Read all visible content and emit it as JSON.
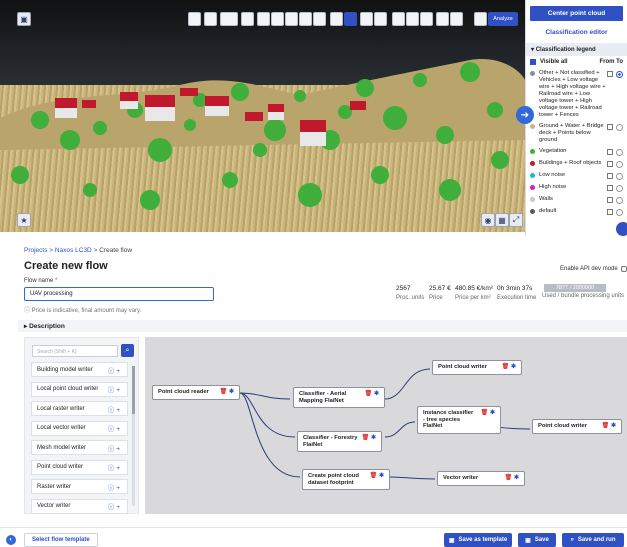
{
  "viewer": {
    "analyze_label": "Analyze",
    "expand_icon": "chevron-right-icon"
  },
  "panel": {
    "center_button": "Center point cloud",
    "classification_editor": "Classification editor",
    "legend_title": "Classification legend",
    "visible_all": "Visible all",
    "from_to": "From To",
    "items": [
      {
        "label": "Other + Not classified + Vehicles + Low voltage wire + High voltage wire + Railroad wire + Low voltage tower + High voltage tower + Railroad tower + Fences",
        "color": "#8a8f96",
        "to_selected": true
      },
      {
        "label": "Ground + Water + Bridge deck + Points below ground",
        "color": "#c9b57c",
        "to_selected": false
      },
      {
        "label": "Vegetation",
        "color": "#3fae3a",
        "to_selected": false
      },
      {
        "label": "Buildings + Roof objects",
        "color": "#c0182c",
        "to_selected": false
      },
      {
        "label": "Low noise",
        "color": "#1fb8c9",
        "to_selected": false
      },
      {
        "label": "High noise",
        "color": "#d21fc9",
        "to_selected": false
      },
      {
        "label": "Walls",
        "color": "#c7c9cc",
        "to_selected": false
      },
      {
        "label": "default",
        "color": "#555a60",
        "to_selected": false
      }
    ]
  },
  "breadcrumb": {
    "projects": "Projects",
    "project": "Naxos LC3D",
    "current": "Create flow"
  },
  "page": {
    "title": "Create new flow",
    "api_dev_mode": "Enable API dev mode",
    "flow_name_label": "Flow name",
    "flow_name_value": "UAV processing",
    "price_info": "Price is indicative, final amount may vary.",
    "description_label": "Description"
  },
  "stats": {
    "proc_units": "2567",
    "proc_units_label": "Proc. units",
    "price": "25.67 €",
    "price_label": "Price",
    "price_per_km": "480.85 €/km²",
    "price_per_km_label": "Price per km²",
    "exec_time": "0h 3min 37s",
    "exec_time_label": "Execution time",
    "used_bundle": "7877 / 2000000",
    "used_bundle_label": "Used / bundle processing units"
  },
  "library": {
    "search_placeholder": "Search (Shift + K)",
    "items": [
      "Building model writer",
      "Local point cloud writer",
      "Local raster writer",
      "Local vector writer",
      "Mesh model writer",
      "Point cloud writer",
      "Raster writer",
      "Vector writer"
    ]
  },
  "flow": {
    "nodes": {
      "reader": "Point cloud reader",
      "aerial": "Classifier - Aerial Mapping FlaiNet",
      "forestry": "Classifier - Forestry FlaiNet",
      "instance": "Instance classifier - tree species FlaiNet",
      "pcw_top": "Point cloud writer",
      "pcw_right": "Point cloud writer",
      "footprint": "Create point cloud dataset footprint",
      "vector": "Vector writer"
    }
  },
  "footer": {
    "select_template": "Select flow template",
    "save_template": "Save as template",
    "save": "Save",
    "save_run": "Save and run"
  }
}
